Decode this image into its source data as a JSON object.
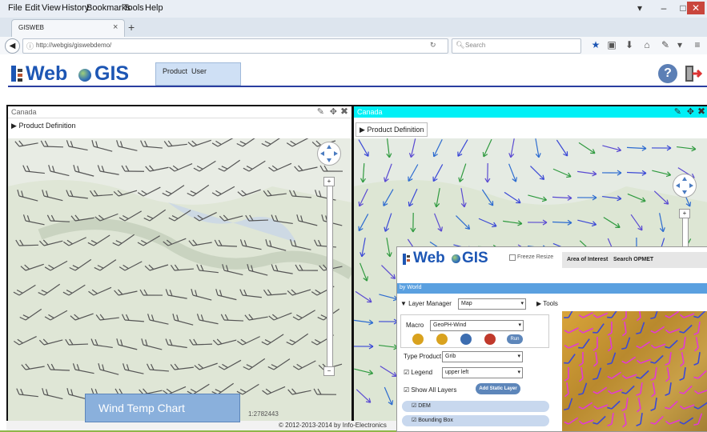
{
  "browser": {
    "menus": [
      "File",
      "Edit",
      "View",
      "History",
      "Bookmarks",
      "Tools",
      "Help"
    ],
    "tab_title": "GISWEB",
    "url": "http://webgis/giswebdemo/",
    "search_placeholder": "Search"
  },
  "app": {
    "logo_text_web": "Web",
    "logo_text_gis": "GIS",
    "nav": [
      "Product",
      "User"
    ]
  },
  "panels": [
    {
      "title": "Canada",
      "product_button": "Product Definition"
    },
    {
      "title": "Canada",
      "product_button": "Product Definition"
    }
  ],
  "caption": "Wind Temp Chart",
  "scale_text": "1:2782443",
  "footer": "© 2012-2013-2014 by Info-Electronics",
  "popup": {
    "logo_web": "Web",
    "logo_gis": "GIS",
    "freeze": "Freeze Resize",
    "menu": [
      "Area of Interest",
      "Search OPMET"
    ],
    "bar_title": "by World",
    "layer_manager": "Layer Manager",
    "layer_select": "Map",
    "tools": "Tools",
    "macro_label": "Macro",
    "macro_value": "GeoPH-Wind",
    "run_label": "Run",
    "type_product_label": "Type Product",
    "type_product_value": "Grib",
    "legend_label": "Legend",
    "legend_value": "upper left",
    "show_all": "Show All Layers",
    "add_static": "Add Static Layer",
    "layers": [
      "DEM",
      "Bounding Box"
    ]
  }
}
